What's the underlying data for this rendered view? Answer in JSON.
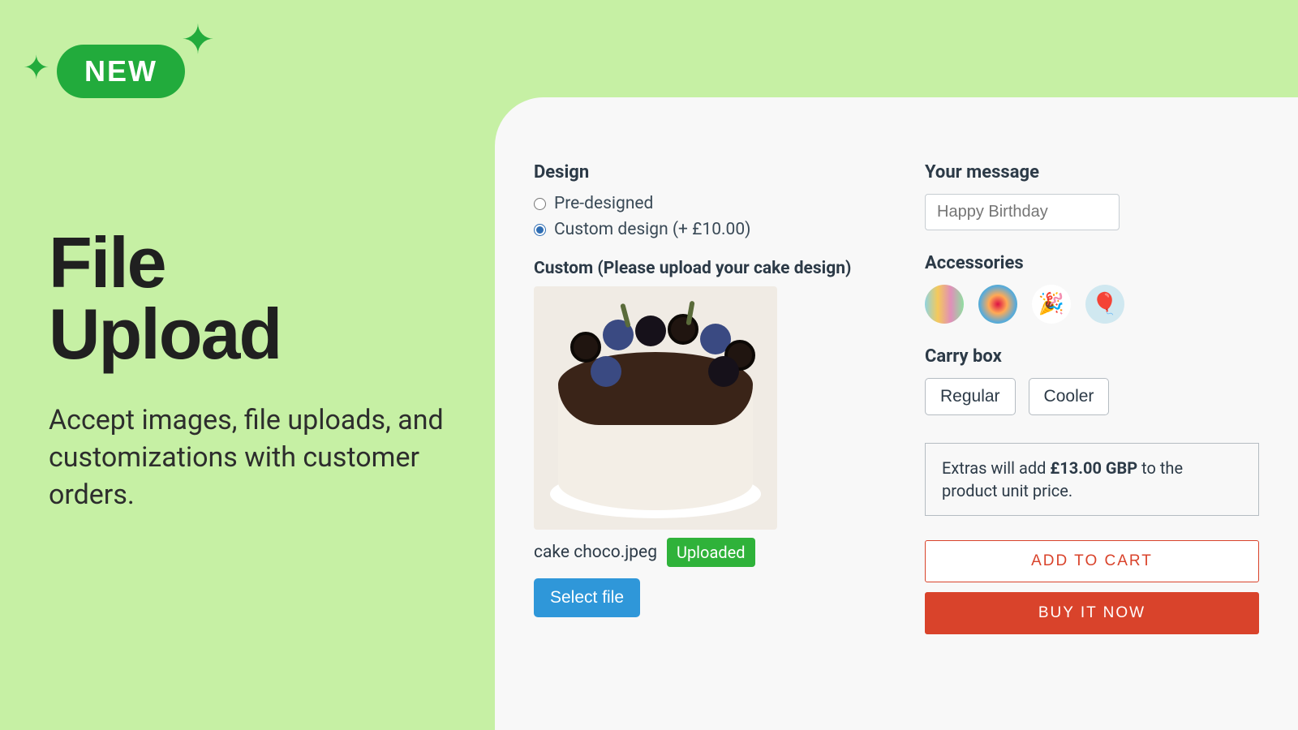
{
  "badge": {
    "label": "NEW"
  },
  "hero": {
    "title_line1": "File",
    "title_line2": "Upload",
    "subtitle": "Accept images, file uploads, and customizations with customer orders."
  },
  "design": {
    "title": "Design",
    "option_pre": "Pre-designed",
    "option_custom": "Custom design (+ £10.00)",
    "selected": "custom",
    "upload_label": "Custom (Please upload your cake design)",
    "file_name": "cake choco.jpeg",
    "uploaded_badge": "Uploaded",
    "select_file_label": "Select file"
  },
  "message": {
    "title": "Your message",
    "placeholder": "Happy Birthday"
  },
  "accessories": {
    "title": "Accessories",
    "items": [
      "candles",
      "sprinkles",
      "party-hat",
      "balloons"
    ]
  },
  "carrybox": {
    "title": "Carry box",
    "options": [
      "Regular",
      "Cooler"
    ]
  },
  "extras": {
    "prefix": "Extras will add ",
    "amount": "£13.00 GBP",
    "suffix": " to the product unit price."
  },
  "actions": {
    "add_to_cart": "ADD TO CART",
    "buy_now": "BUY IT NOW"
  }
}
